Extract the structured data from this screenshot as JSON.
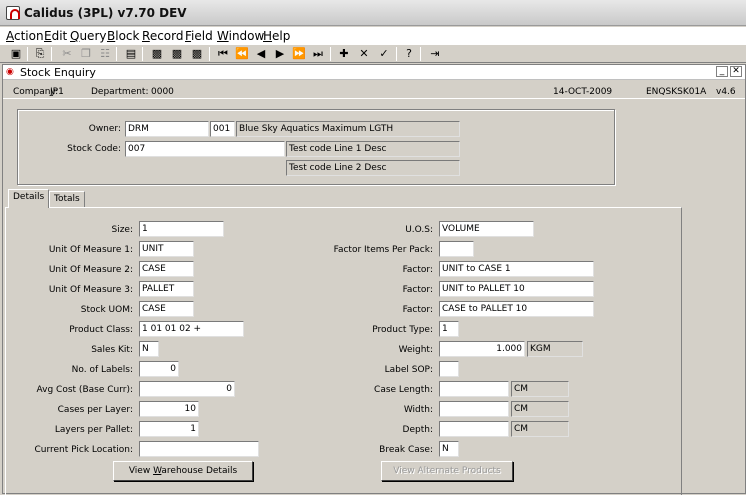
{
  "window": {
    "title": "Calidus (3PL) v7.70 DEV"
  },
  "menu": {
    "items": [
      {
        "label": "Action",
        "underline": "A",
        "rest": "ction"
      },
      {
        "label": "Edit",
        "underline": "E",
        "rest": "dit"
      },
      {
        "label": "Query",
        "underline": "Q",
        "rest": "uery"
      },
      {
        "label": "Block",
        "underline": "B",
        "rest": "lock"
      },
      {
        "label": "Record",
        "underline": "R",
        "rest": "ecord"
      },
      {
        "label": "Field",
        "underline": "F",
        "rest": "ield"
      },
      {
        "label": "Window",
        "underline": "W",
        "rest": "indow"
      },
      {
        "label": "Help",
        "underline": "H",
        "rest": "elp"
      }
    ]
  },
  "toolbar": {
    "icons": [
      "save-icon",
      "print-icon",
      "cut-icon",
      "copy-icon",
      "paste-icon",
      "clear-icon",
      "enter-query-icon",
      "execute-query-icon",
      "cancel-query-icon",
      "first-record-icon",
      "previous-block-icon",
      "previous-record-icon",
      "next-record-icon",
      "next-block-icon",
      "last-record-icon",
      "insert-record-icon",
      "delete-record-icon",
      "duplicate-record-icon",
      "help-icon",
      "exit-icon"
    ]
  },
  "document": {
    "title": "Stock Enquiry",
    "company_label": "Company:",
    "company_value": "JP1",
    "department_label": "Department:",
    "department_value": "0000",
    "date": "14-OCT-2009",
    "form_code": "ENQSKSK01A",
    "version": "v4.6"
  },
  "header": {
    "owner_label": "Owner:",
    "owner_code": "DRM",
    "owner_num": "001",
    "owner_name": "Blue Sky Aquatics Maximum LGTH",
    "stock_code_label": "Stock Code:",
    "stock_code": "007",
    "desc1": "Test code Line 1 Desc",
    "desc2": "Test code Line 2 Desc"
  },
  "tabs": [
    {
      "label": "Details",
      "active": true
    },
    {
      "label": "Totals",
      "active": false
    }
  ],
  "details": {
    "size_label": "Size:",
    "size": "1",
    "uom1_label": "Unit Of Measure 1:",
    "uom1": "UNIT",
    "uom2_label": "Unit Of Measure 2:",
    "uom2": "CASE",
    "uom3_label": "Unit Of Measure 3:",
    "uom3": "PALLET",
    "stock_uom_label": "Stock UOM:",
    "stock_uom": "CASE",
    "product_class_label": "Product Class:",
    "product_class": "1 01  01 02 +",
    "sales_kit_label": "Sales Kit:",
    "sales_kit": "N",
    "labels_label": "No. of Labels:",
    "labels": "0",
    "avg_cost_label": "Avg Cost (Base Curr):",
    "avg_cost": "0",
    "cases_layer_label": "Cases per Layer:",
    "cases_layer": "10",
    "layers_pallet_label": "Layers per Pallet:",
    "layers_pallet": "1",
    "pick_loc_label": "Current Pick Location:",
    "pick_loc": "",
    "uos_label": "U.O.S:",
    "uos": "VOLUME",
    "factor_items_label": "Factor Items Per Pack:",
    "factor_items": "",
    "factor1_label": "Factor:",
    "factor1": "UNIT to CASE 1",
    "factor2_label": "Factor:",
    "factor2": "UNIT to PALLET 10",
    "factor3_label": "Factor:",
    "factor3": "CASE to PALLET 10",
    "product_type_label": "Product Type:",
    "product_type": "1",
    "weight_label": "Weight:",
    "weight": "1.000",
    "weight_unit": "KGM",
    "label_sop_label": "Label SOP:",
    "label_sop": "",
    "case_length_label": "Case Length:",
    "case_length": "",
    "case_length_unit": "CM",
    "width_label": "Width:",
    "width": "",
    "width_unit": "CM",
    "depth_label": "Depth:",
    "depth": "",
    "depth_unit": "CM",
    "break_case_label": "Break Case:",
    "break_case": "N",
    "view_warehouse_pre": "View ",
    "view_warehouse_u": "W",
    "view_warehouse_post": "arehouse Details",
    "view_alternate": "View Alternate Products"
  }
}
